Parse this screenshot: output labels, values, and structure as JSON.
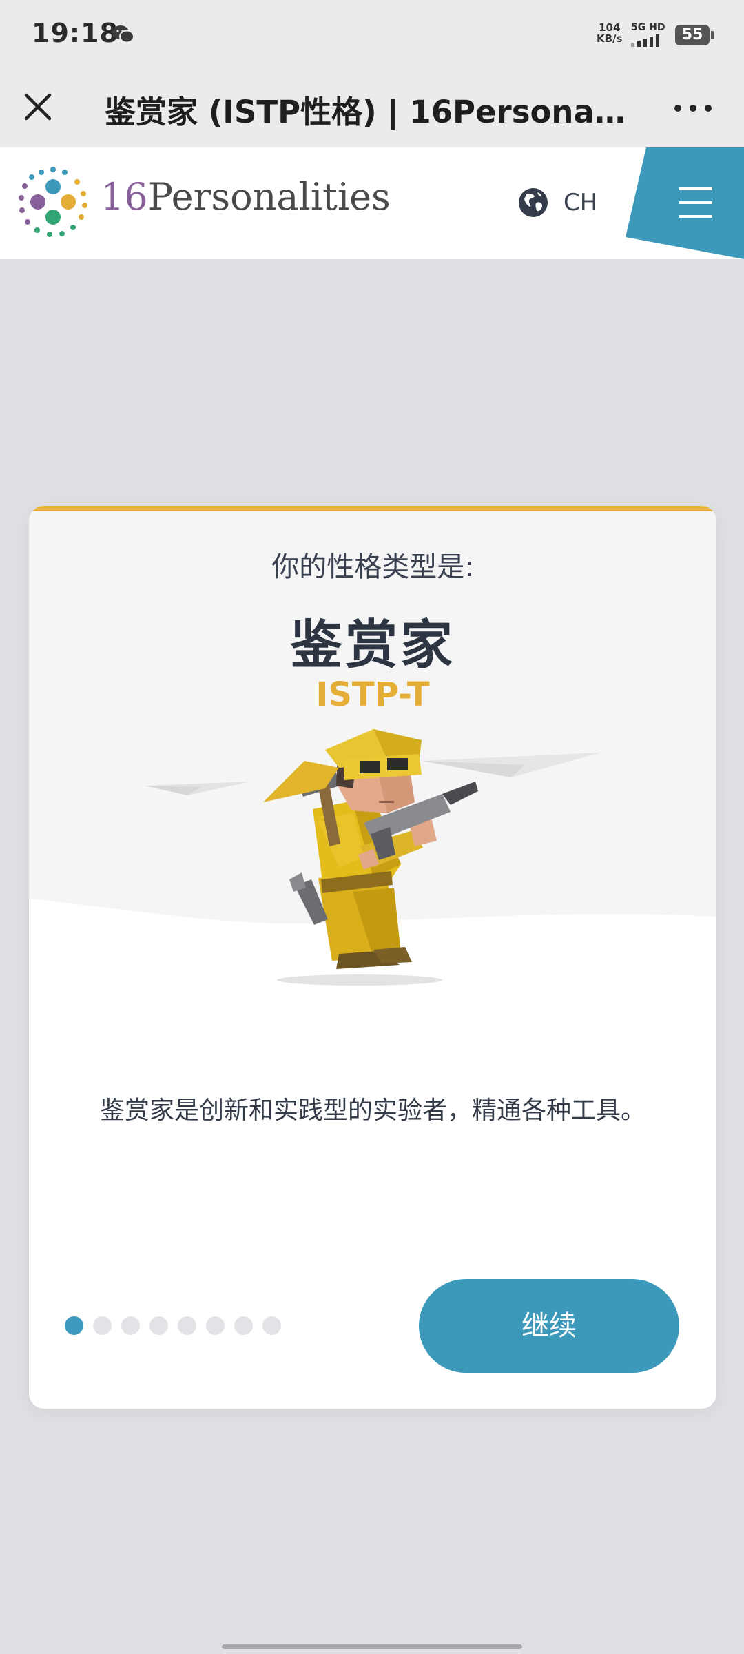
{
  "status_bar": {
    "time": "19:18",
    "net_speed_value": "104",
    "net_speed_unit": "KB/s",
    "network_label": "5G HD",
    "battery": "55"
  },
  "browser": {
    "title": "鉴赏家 (ISTP性格) | 16Personalit…"
  },
  "site_header": {
    "logo_number": "16",
    "logo_word": "Personalities",
    "language": "CH"
  },
  "card": {
    "subtitle": "你的性格类型是:",
    "type_name": "鉴赏家",
    "type_code": "ISTP-T",
    "description": "鉴赏家是创新和实践型的实验者，精通各种工具。",
    "continue_label": "继续",
    "pagination": {
      "total": 8,
      "current": 1
    }
  },
  "colors": {
    "accent_blue": "#3d99ba",
    "accent_yellow": "#e5b432",
    "logo_purple": "#88619a"
  }
}
